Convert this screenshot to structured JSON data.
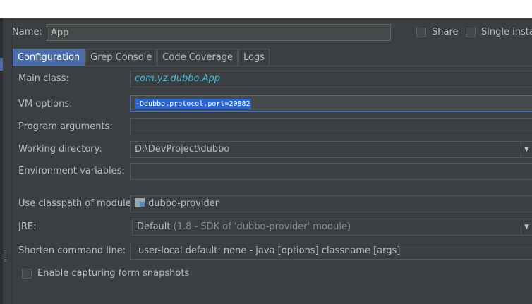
{
  "header": {
    "name_label": "Name:",
    "name_value": "App",
    "share_label": "Share",
    "single_instance_label": "Single instan"
  },
  "tabs": [
    {
      "label": "Configuration",
      "active": true
    },
    {
      "label": "Grep Console",
      "active": false
    },
    {
      "label": "Code Coverage",
      "active": false
    },
    {
      "label": "Logs",
      "active": false
    }
  ],
  "form": {
    "main_class": {
      "label": "Main class:",
      "value": "com.yz.dubbo.App"
    },
    "vm_options": {
      "label": "VM options:",
      "value": "-Ddubbo.protocol.port=20882"
    },
    "program_arguments": {
      "label": "Program arguments:",
      "value": ""
    },
    "working_directory": {
      "label": "Working directory:",
      "value": "D:\\DevProject\\dubbo"
    },
    "environment_variables": {
      "label": "Environment variables:",
      "value": ""
    },
    "classpath_module": {
      "label": "Use classpath of module:",
      "value": "dubbo-provider"
    },
    "jre": {
      "label": "JRE:",
      "value": "Default",
      "detail": "(1.8 - SDK of 'dubbo-provider' module)"
    },
    "shorten_command_line": {
      "label": "Shorten command line:",
      "value": "user-local default: none",
      "detail": "- java [options] classname [args]"
    },
    "capture_snapshots": {
      "label": "Enable capturing form snapshots",
      "checked": false
    }
  },
  "colors": {
    "background": "#3c3f41",
    "accent": "#4a6da7",
    "class_name": "#4fbbd4",
    "selection": "#2f65ca"
  },
  "icons": [
    "module-icon",
    "combo-arrow-icon",
    "checkbox-icon"
  ]
}
